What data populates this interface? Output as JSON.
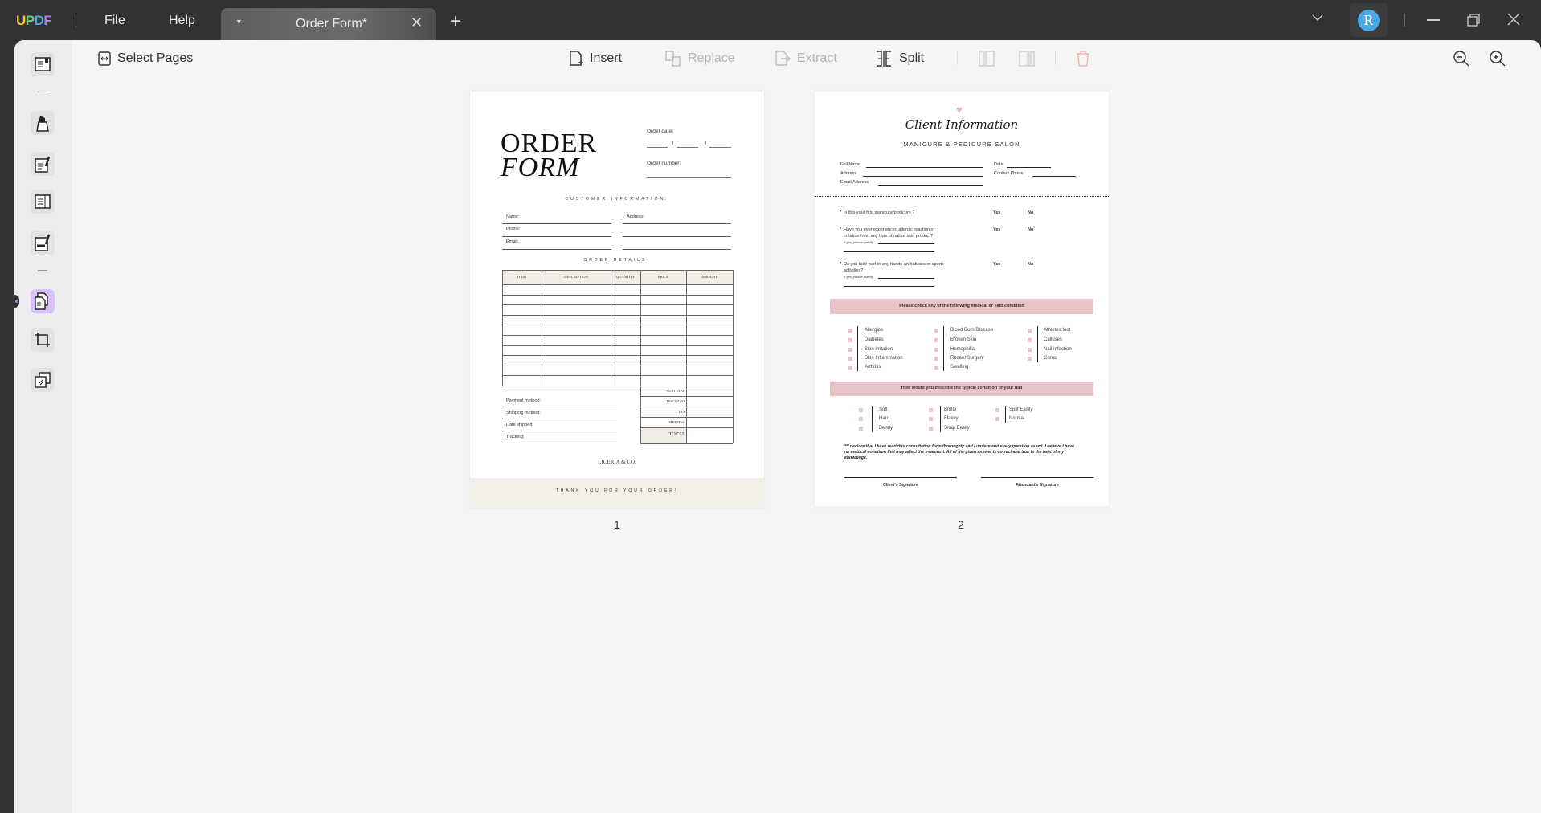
{
  "app": {
    "logo": "UPDF",
    "menu": {
      "file": "File",
      "help": "Help"
    },
    "tab": {
      "title": "Order Form*"
    },
    "avatar_letter": "R",
    "accent": "#a77bf3",
    "avatar_color": "#4aa8e6"
  },
  "toolbar": {
    "select_pages": "Select Pages",
    "insert": "Insert",
    "replace": "Replace",
    "extract": "Extract",
    "split": "Split"
  },
  "sidebar": {
    "items": [
      "reader-icon",
      "comment-icon",
      "edit-icon",
      "form-icon",
      "fill-sign-icon",
      "organize-pages-icon",
      "crop-icon",
      "overlay-icon"
    ],
    "active": "organize-pages-icon"
  },
  "pages": [
    {
      "number": "1",
      "title_line1": "ORDER",
      "title_line2": "FORM",
      "order_date": "Order date:",
      "order_number": "Order number:",
      "customer_info": "CUSTOMER INFORMATION:",
      "fields_left": [
        "Name:",
        "Phone:",
        "Email:"
      ],
      "fields_right": [
        "Address:"
      ],
      "order_details": "ORDER DETAILS:",
      "columns": [
        "ITEM",
        "DESCRIPTION",
        "QUANTITY",
        "PRICE",
        "AMOUNT"
      ],
      "totals": [
        "SUBTOTAL",
        "DISCOUNT",
        "TAX",
        "SHIPPING",
        "TOTAL"
      ],
      "ship_fields": [
        "Payment method:",
        "Shipping method:",
        "Date shipped:",
        "Tracking:"
      ],
      "company": "LICERIA & CO.",
      "footer": "THANK YOU FOR YOUR ORDER!"
    },
    {
      "number": "2",
      "title": "Client Information",
      "subtitle": "MANICURE & PEDICURE SALON",
      "fields_left": [
        "Full Name",
        "Address",
        "Email Address"
      ],
      "fields_right": [
        "Date",
        "Contact Phone"
      ],
      "questions": [
        {
          "text": "Is this your first manicure/pedicure ?",
          "yes": "Yes",
          "no": "No"
        },
        {
          "text": "Have you ever experienced allergic reaction or irritation from any type of nail or skin product?",
          "yes": "Yes",
          "no": "No",
          "specify": "If yes, please specify"
        },
        {
          "text": "Do you take part in any hands-on hobbies or sports activities?",
          "yes": "Yes",
          "no": "No",
          "specify": "If yes, please specify"
        }
      ],
      "band1": "Please check any of the following medical or skin condition",
      "conditions": [
        [
          "Allergies",
          "Diabetes",
          "Skin Irritation",
          "Skin Inflammation",
          "Arthritis"
        ],
        [
          "Blood Born Disease",
          "Broken Skin",
          "Hemophilia",
          "Recent Surgery",
          "Swelling"
        ],
        [
          "Athletes foot",
          "Calluses",
          "Nail Infection",
          "Corns"
        ]
      ],
      "band2": "How would you describe the typical condition of your nail",
      "nail": [
        [
          "Soft",
          "Hard",
          "Bendy"
        ],
        [
          "Brittle",
          "Flakey",
          "Snap Easily"
        ],
        [
          "Split Easily",
          "Normal"
        ]
      ],
      "declaration": "**I declare that I have read this consultation form thoroughly and I understand every question asked. I believe I have no medical condition that may affect the treatment. All of the given answer is correct and true to the best of my knowledge.",
      "sig_client": "Client's Signature",
      "sig_attendant": "Attendant's Signature",
      "band_color": "#e8c4c6"
    }
  ]
}
